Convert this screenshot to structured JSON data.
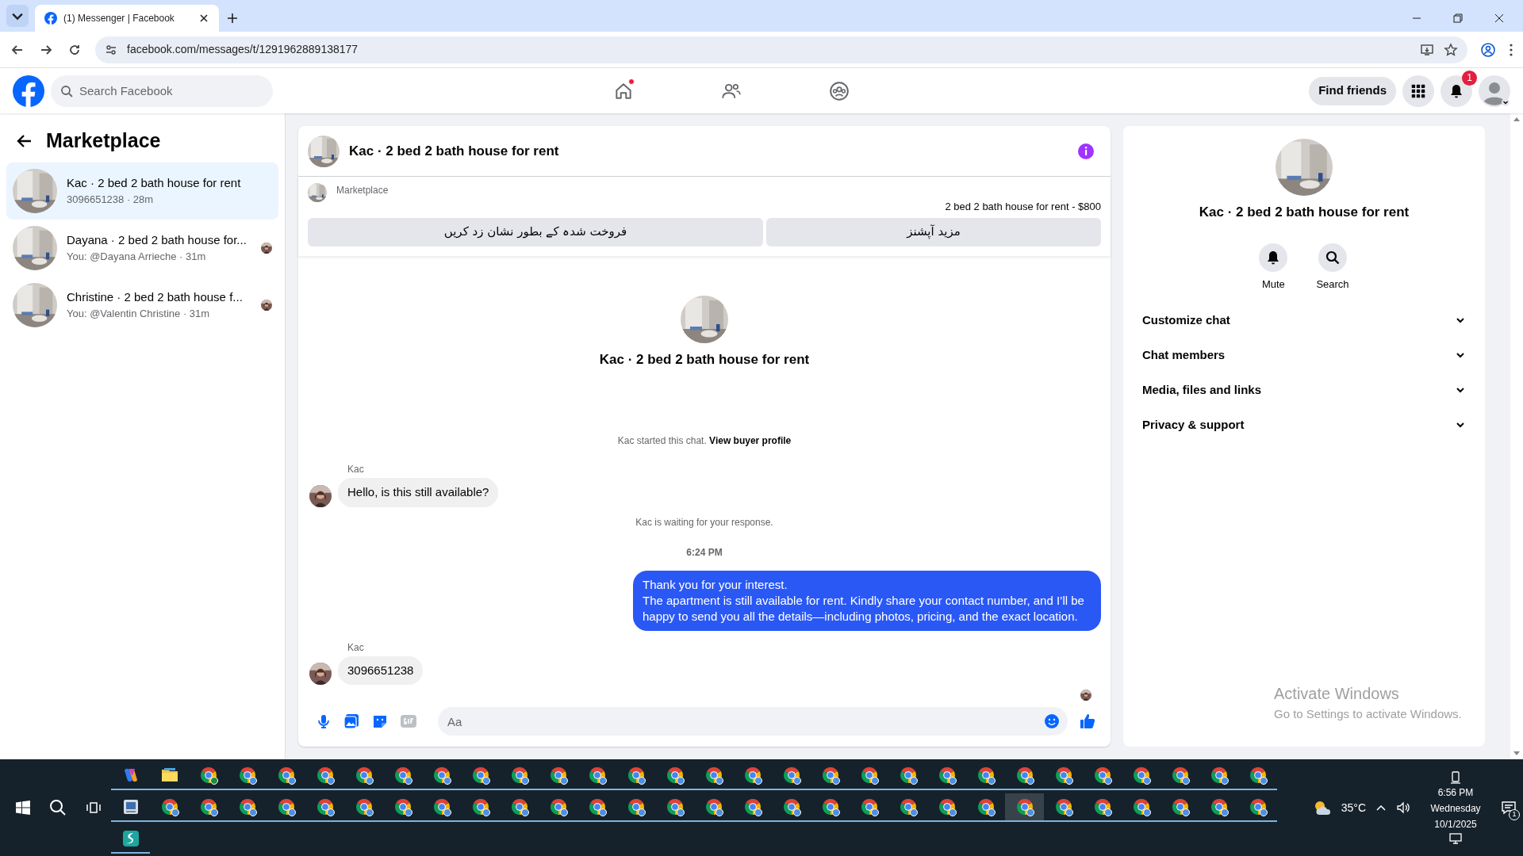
{
  "browser": {
    "tab": {
      "title": "(1) Messenger | Facebook",
      "selected": true
    },
    "url": "facebook.com/messages/t/1291962889138177"
  },
  "header": {
    "search": {
      "placeholder": "Search Facebook"
    },
    "nav": [
      {
        "kind": "home",
        "selected": false,
        "dot": true
      },
      {
        "kind": "friends",
        "selected": false,
        "dot": false
      },
      {
        "kind": "groups",
        "selected": false,
        "dot": false
      }
    ],
    "find_friends": "Find friends",
    "notification_count": "1"
  },
  "sidebar": {
    "title": "Marketplace",
    "conversations": [
      {
        "title": "Kac · 2 bed 2 bath house for rent",
        "subtitle": "3096651238 · 28m",
        "selected": true,
        "seen": false
      },
      {
        "title": "Dayana · 2 bed 2 bath house for...",
        "subtitle": "You: @Dayana Arrieche · 31m",
        "selected": false,
        "seen": true
      },
      {
        "title": "Christine · 2 bed 2 bath house f...",
        "subtitle": "You: @Valentin Christine · 31m",
        "selected": false,
        "seen": true
      }
    ]
  },
  "chat": {
    "title": "Kac · 2 bed 2 bath house for rent",
    "listing": {
      "label": "Marketplace",
      "title": "2 bed 2 bath house for rent - $800",
      "buttons": [
        "مزید آپشنز",
        "فروخت شدہ کے بطور نشان زد کریں"
      ]
    },
    "profile_name": "Kac · 2 bed 2 bath house for rent",
    "messages": [
      {
        "kind": "system",
        "text": "Kac started this chat. ",
        "link": "View buyer profile"
      },
      {
        "kind": "incoming",
        "sender": "Kac",
        "text": "Hello, is this still available?"
      },
      {
        "kind": "system",
        "text": "Kac is waiting for your response."
      },
      {
        "kind": "timestamp",
        "text": "6:24 PM"
      },
      {
        "kind": "outgoing",
        "text": "Thank you for your interest.\nThe apartment is still available for rent. Kindly share your contact number, and I’ll be happy to send you all the details—including photos, pricing, and the exact location."
      },
      {
        "kind": "incoming",
        "sender": "Kac",
        "text": "3096651238"
      }
    ],
    "composer": {
      "placeholder": "Aa"
    }
  },
  "details": {
    "name": "Kac · 2 bed 2 bath house for rent",
    "actions": [
      {
        "kind": "bell",
        "label": "Mute"
      },
      {
        "kind": "search",
        "label": "Search"
      }
    ],
    "sections": [
      {
        "label": "Customize chat",
        "expanded": false
      },
      {
        "label": "Chat members",
        "expanded": false
      },
      {
        "label": "Media, files and links",
        "expanded": false
      },
      {
        "label": "Privacy & support",
        "expanded": false
      }
    ]
  },
  "activation": {
    "title": "Activate Windows",
    "text": "Go to Settings to activate Windows."
  },
  "taskbar": {
    "rows": [
      [
        {
          "kind": "copilot",
          "selected": false
        },
        {
          "kind": "folder",
          "selected": false
        },
        {
          "kind": "chrome-green",
          "selected": false
        },
        {
          "kind": "chrome",
          "selected": false
        },
        {
          "kind": "chrome",
          "selected": false
        },
        {
          "kind": "chrome",
          "selected": false
        },
        {
          "kind": "chrome",
          "selected": false
        },
        {
          "kind": "chrome",
          "selected": false
        },
        {
          "kind": "chrome",
          "selected": false
        },
        {
          "kind": "chrome",
          "selected": false
        },
        {
          "kind": "chrome",
          "selected": false
        },
        {
          "kind": "chrome",
          "selected": false
        },
        {
          "kind": "chrome",
          "selected": false
        },
        {
          "kind": "chrome",
          "selected": false
        },
        {
          "kind": "chrome",
          "selected": false
        },
        {
          "kind": "chrome",
          "selected": false
        },
        {
          "kind": "chrome",
          "selected": false
        },
        {
          "kind": "chrome",
          "selected": false
        },
        {
          "kind": "chrome",
          "selected": false
        },
        {
          "kind": "chrome",
          "selected": false
        },
        {
          "kind": "chrome",
          "selected": false
        },
        {
          "kind": "chrome",
          "selected": false
        },
        {
          "kind": "chrome",
          "selected": false
        },
        {
          "kind": "chrome",
          "selected": false
        },
        {
          "kind": "chrome",
          "selected": false
        },
        {
          "kind": "chrome",
          "selected": false
        },
        {
          "kind": "chrome",
          "selected": false
        },
        {
          "kind": "chrome",
          "selected": false
        },
        {
          "kind": "chrome",
          "selected": false
        },
        {
          "kind": "chrome",
          "selected": false
        }
      ],
      [
        {
          "kind": "idcard",
          "selected": false
        },
        {
          "kind": "chrome",
          "selected": false
        },
        {
          "kind": "chrome",
          "selected": false
        },
        {
          "kind": "chrome",
          "selected": false
        },
        {
          "kind": "chrome",
          "selected": false
        },
        {
          "kind": "chrome",
          "selected": false
        },
        {
          "kind": "chrome",
          "selected": false
        },
        {
          "kind": "chrome",
          "selected": false
        },
        {
          "kind": "chrome",
          "selected": false
        },
        {
          "kind": "chrome",
          "selected": false
        },
        {
          "kind": "chrome",
          "selected": false
        },
        {
          "kind": "chrome",
          "selected": false
        },
        {
          "kind": "chrome",
          "selected": false
        },
        {
          "kind": "chrome",
          "selected": false
        },
        {
          "kind": "chrome",
          "selected": false
        },
        {
          "kind": "chrome",
          "selected": false
        },
        {
          "kind": "chrome",
          "selected": false
        },
        {
          "kind": "chrome",
          "selected": false
        },
        {
          "kind": "chrome",
          "selected": false
        },
        {
          "kind": "chrome",
          "selected": false
        },
        {
          "kind": "chrome",
          "selected": false
        },
        {
          "kind": "chrome",
          "selected": false
        },
        {
          "kind": "chrome",
          "selected": false
        },
        {
          "kind": "chrome",
          "selected": true
        },
        {
          "kind": "chrome",
          "selected": false
        },
        {
          "kind": "chrome",
          "selected": false
        },
        {
          "kind": "chrome",
          "selected": false
        },
        {
          "kind": "chrome",
          "selected": false
        },
        {
          "kind": "chrome",
          "selected": false
        },
        {
          "kind": "chrome",
          "selected": false
        }
      ],
      [
        {
          "kind": "surfshark",
          "selected": false
        }
      ]
    ],
    "weather": "35°C",
    "time": "6:56 PM",
    "day": "Wednesday",
    "date": "10/1/2025",
    "notifications": "1"
  }
}
